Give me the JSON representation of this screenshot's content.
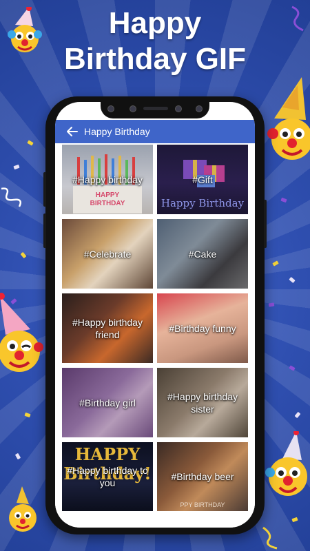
{
  "banner": {
    "line1": "Happy",
    "line2": "Birthday GIF"
  },
  "app": {
    "title": "Happy Birthday",
    "back_icon": "arrow-left-icon",
    "accent": "#3f65c9"
  },
  "categories": [
    {
      "label": "#Happy birthday",
      "image_text": "HAPPY BIRTHDAY"
    },
    {
      "label": "#Gift",
      "image_text": "Happy Birthday"
    },
    {
      "label": "#Celebrate"
    },
    {
      "label": "#Cake"
    },
    {
      "label": "#Happy birthday friend"
    },
    {
      "label": "#Birthday funny"
    },
    {
      "label": "#Birthday girl"
    },
    {
      "label": "#Happy birthday sister"
    },
    {
      "label": "#Happy birthday to you",
      "image_text": "HAPPY Birthday!"
    },
    {
      "label": "#Birthday beer",
      "image_text": "PPY BIRTHDAY"
    }
  ]
}
